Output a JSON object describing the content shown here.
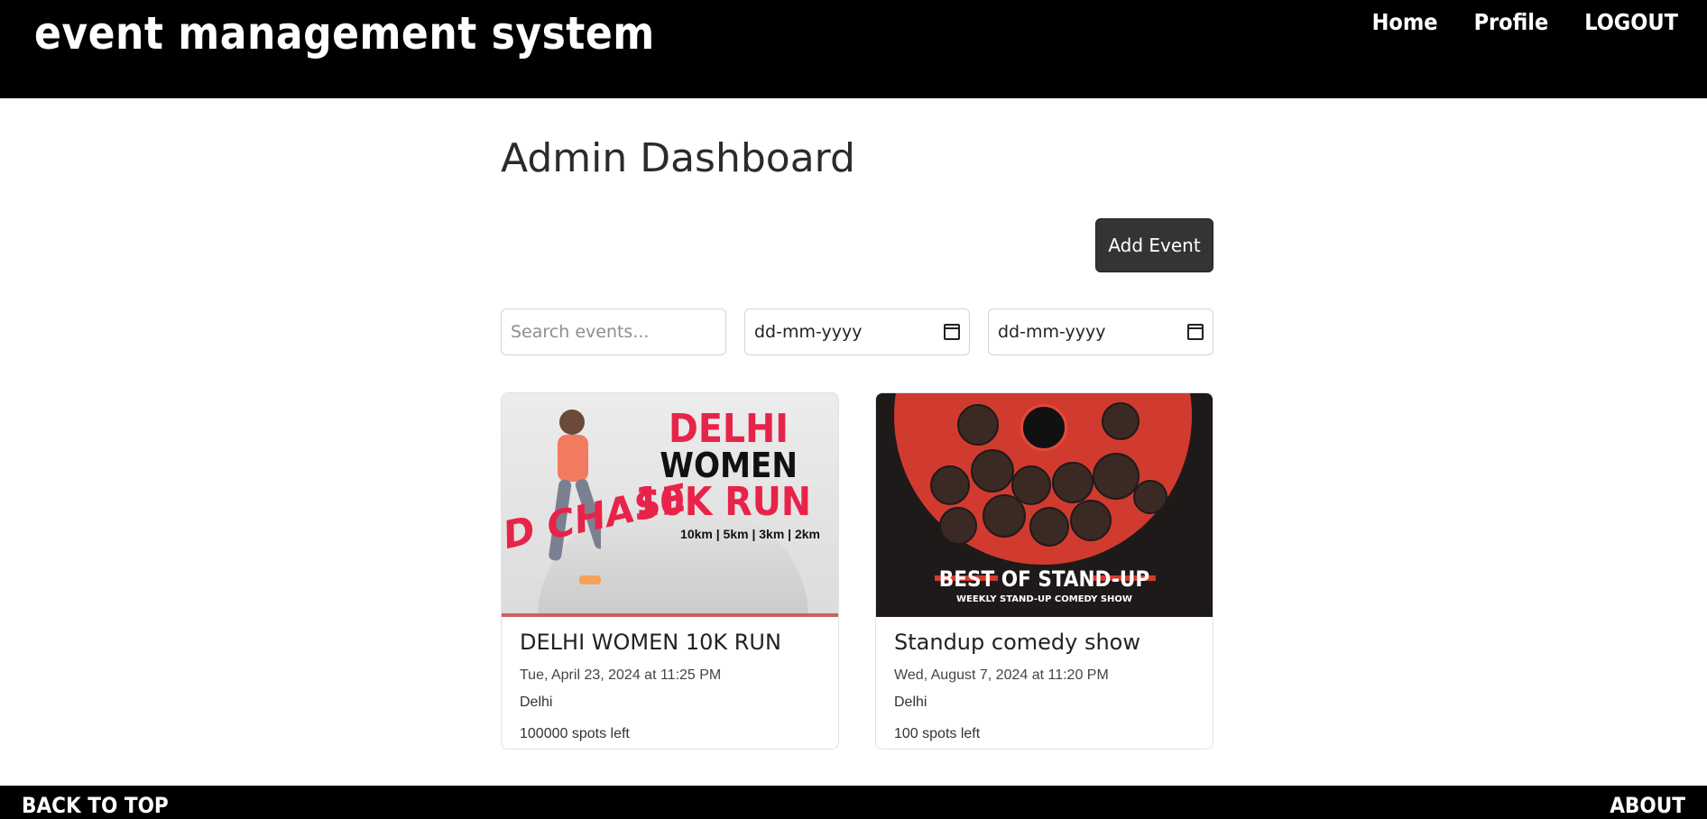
{
  "header": {
    "brand": "event management system",
    "nav": [
      "Home",
      "Profile",
      "LOGOUT"
    ]
  },
  "main": {
    "title": "Admin Dashboard",
    "add_event_label": "Add Event",
    "search_placeholder": "Search events...",
    "date_from_placeholder": "dd-mm-yyyy",
    "date_to_placeholder": "dd-mm-yyyy"
  },
  "events": [
    {
      "title": "DELHI WOMEN 10K RUN",
      "date": "Tue, April 23, 2024 at 11:25 PM",
      "location": "Delhi",
      "spots": "100000 spots left",
      "image": {
        "line1": "DELHI",
        "line2": "WOMEN",
        "line3": "10K RUN",
        "distances": "10km | 5km | 3km | 2km",
        "side_text": "D CHASE"
      }
    },
    {
      "title": "Standup comedy show",
      "date": "Wed, August 7, 2024 at 11:20 PM",
      "location": "Delhi",
      "spots": "100 spots left",
      "image": {
        "headline": "BEST OF STAND-UP",
        "subline": "WEEKLY STAND-UP COMEDY SHOW"
      }
    }
  ],
  "footer": {
    "back_to_top": "BACK TO TOP",
    "about": "ABOUT"
  },
  "colors": {
    "header_bg": "#000000",
    "button_bg": "#343434",
    "accent_red": "#e8234a"
  }
}
